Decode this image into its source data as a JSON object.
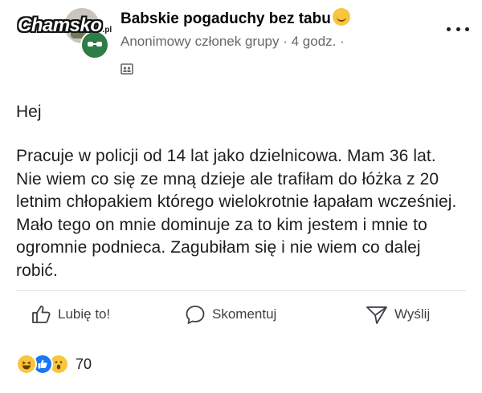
{
  "watermark": {
    "text": "Chamsko",
    "suffix": ".pl"
  },
  "header": {
    "group_name": "Babskie pogaduchy bez tabu",
    "author": "Anonimowy członek grupy",
    "time": "4 godz.",
    "separator": "·",
    "trailing_separator": "·"
  },
  "icons": {
    "avatar_badge": "anonymous-icon",
    "privacy": "group-members-icon",
    "more": "more-icon",
    "like": "thumbs-up-icon",
    "comment": "comment-bubble-icon",
    "share": "send-icon"
  },
  "post": {
    "greeting": "Hej",
    "message": "Pracuje w policji od 14 lat jako dzielnicowa. Mam 36 lat. Nie wiem co się ze mną dzieje ale trafiłam do łóżka z 20 letnim chłopakiem którego wielokrotnie łapałam wcześniej. Mało tego on mnie dominuje za to kim jestem i mnie to ogromnie podnieca. Zagubiłam się i nie wiem co dalej robić."
  },
  "actions": {
    "like": "Lubię to!",
    "comment": "Skomentuj",
    "share": "Wyślij"
  },
  "reactions": {
    "types": [
      "haha",
      "like",
      "wow"
    ],
    "count": "70"
  },
  "colors": {
    "text": "#1c1e21",
    "meta": "#65676b",
    "like_blue": "#1877f2",
    "emoji_yellow": "#f7c63e"
  }
}
